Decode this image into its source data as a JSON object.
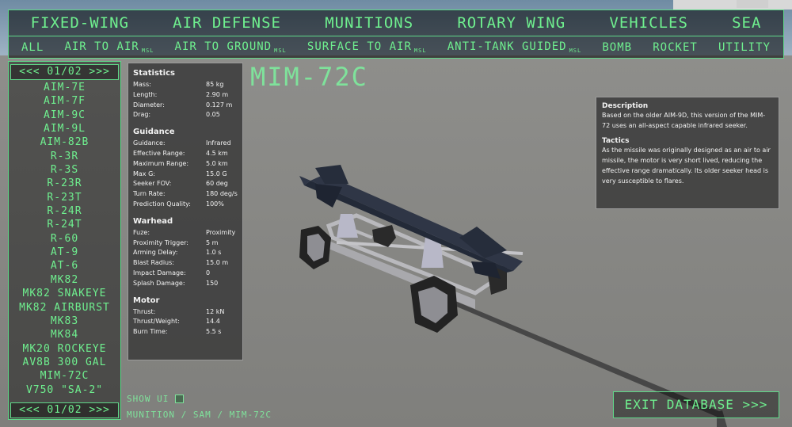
{
  "nav": {
    "categories": [
      "FIXED-WING",
      "AIR DEFENSE",
      "MUNITIONS",
      "ROTARY WING",
      "VEHICLES",
      "SEA"
    ]
  },
  "subnav": {
    "items": [
      {
        "label": "ALL",
        "suffix": ""
      },
      {
        "label": "AIR TO AIR",
        "suffix": "MSL"
      },
      {
        "label": "AIR TO GROUND",
        "suffix": "MSL"
      },
      {
        "label": "SURFACE TO AIR",
        "suffix": "MSL"
      },
      {
        "label": "ANTI-TANK GUIDED",
        "suffix": "MSL"
      },
      {
        "label": "BOMB",
        "suffix": ""
      },
      {
        "label": "ROCKET",
        "suffix": ""
      },
      {
        "label": "UTILITY",
        "suffix": ""
      }
    ]
  },
  "list": {
    "pager_label": "<<< 01/02 >>>",
    "items": [
      "AIM-7E",
      "AIM-7F",
      "AIM-9C",
      "AIM-9L",
      "AIM-82B",
      "R-3R",
      "R-3S",
      "R-23R",
      "R-23T",
      "R-24R",
      "R-24T",
      "R-60",
      "AT-9",
      "AT-6",
      "MK82",
      "MK82 SNAKEYE",
      "MK82 AIRBURST",
      "MK83",
      "MK84",
      "MK20 ROCKEYE",
      "AV8B 300 GAL",
      "MIM-72C",
      "V750 \"SA-2\""
    ]
  },
  "title": "MIM-72C",
  "stats": {
    "sections": [
      {
        "heading": "Statistics",
        "rows": [
          {
            "k": "Mass:",
            "v": "85 kg"
          },
          {
            "k": "Length:",
            "v": "2.90 m"
          },
          {
            "k": "Diameter:",
            "v": "0.127 m"
          },
          {
            "k": "Drag:",
            "v": "0.05"
          }
        ]
      },
      {
        "heading": "Guidance",
        "rows": [
          {
            "k": "Guidance:",
            "v": "Infrared"
          },
          {
            "k": "Effective Range:",
            "v": "4.5 km"
          },
          {
            "k": "Maximum Range:",
            "v": "5.0 km"
          },
          {
            "k": "Max G:",
            "v": "15.0 G"
          },
          {
            "k": "Seeker FOV:",
            "v": "60 deg"
          },
          {
            "k": "Turn Rate:",
            "v": "180 deg/s"
          },
          {
            "k": "Prediction Quality:",
            "v": "100%"
          }
        ]
      },
      {
        "heading": "Warhead",
        "rows": [
          {
            "k": "Fuze:",
            "v": "Proximity"
          },
          {
            "k": "Proximity Trigger:",
            "v": "5 m"
          },
          {
            "k": "Arming Delay:",
            "v": "1.0 s"
          },
          {
            "k": "Blast Radius:",
            "v": "15.0 m"
          },
          {
            "k": "Impact Damage:",
            "v": "0"
          },
          {
            "k": "Splash Damage:",
            "v": "150"
          }
        ]
      },
      {
        "heading": "Motor",
        "rows": [
          {
            "k": "Thrust:",
            "v": "12 kN"
          },
          {
            "k": "Thrust/Weight:",
            "v": "14.4"
          },
          {
            "k": "Burn Time:",
            "v": "5.5 s"
          }
        ]
      }
    ]
  },
  "description": {
    "heading": "Description",
    "text": "Based on the older AIM-9D, this version of the MIM-72 uses an all-aspect capable infrared seeker.",
    "tactics_heading": "Tactics",
    "tactics_text": "As the missile was originally designed as an air to air missile, the motor is very short lived, reducing the effective range dramatically. Its older seeker head is very susceptible to flares."
  },
  "footer": {
    "show_ui_label": "SHOW UI",
    "breadcrumb": "MUNITION / SAM / MIM-72C",
    "exit_label": "EXIT DATABASE >>>"
  }
}
